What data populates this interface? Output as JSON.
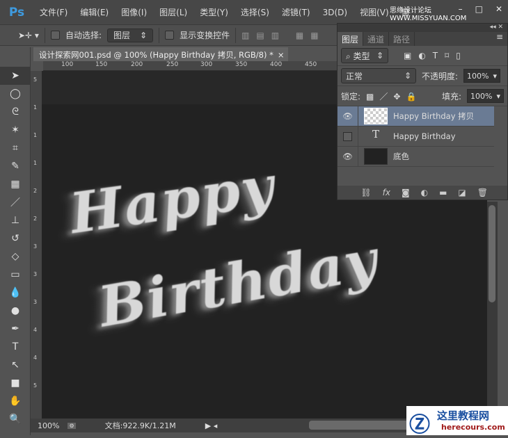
{
  "app": {
    "logo": "Ps",
    "menus": [
      "文件(F)",
      "编辑(E)",
      "图像(I)",
      "图层(L)",
      "类型(Y)",
      "选择(S)",
      "滤镜(T)",
      "3D(D)",
      "视图(V)",
      "窗"
    ],
    "watermark": "思缘设计论坛 WWW.MISSYUAN.COM"
  },
  "options": {
    "auto_select_label": "自动选择:",
    "auto_select_value": "图层",
    "show_transform_label": "显示变换控件"
  },
  "document": {
    "tab_title": "设计探索网001.psd @ 100% (Happy    Birthday 拷贝, RGB/8) *",
    "close": "×",
    "ruler_ticks": [
      "100",
      "150",
      "200",
      "250",
      "300",
      "350",
      "400",
      "450"
    ],
    "vruler_ticks": [
      "5",
      "1",
      "1",
      "1",
      "2",
      "2",
      "3",
      "3",
      "3",
      "4",
      "4",
      "5"
    ],
    "art_line1": "Happy",
    "art_line2": "Birthday"
  },
  "status": {
    "zoom": "100%",
    "doc_info": "文档:922.9K/1.21M"
  },
  "layers_panel": {
    "tabs": [
      "图层",
      "通道",
      "路径"
    ],
    "filter_label": "类型",
    "blend_mode": "正常",
    "opacity_label": "不透明度:",
    "opacity": "100%",
    "lock_label": "锁定:",
    "fill_label": "填充:",
    "fill": "100%",
    "layers": [
      {
        "name": "Happy   Birthday 拷贝",
        "visible": true,
        "selected": true
      },
      {
        "name": "Happy   Birthday",
        "visible": false,
        "selected": false
      },
      {
        "name": "底色",
        "visible": true,
        "selected": false
      }
    ]
  },
  "brand": {
    "name": "这里教程网",
    "url": "herecours.com"
  }
}
